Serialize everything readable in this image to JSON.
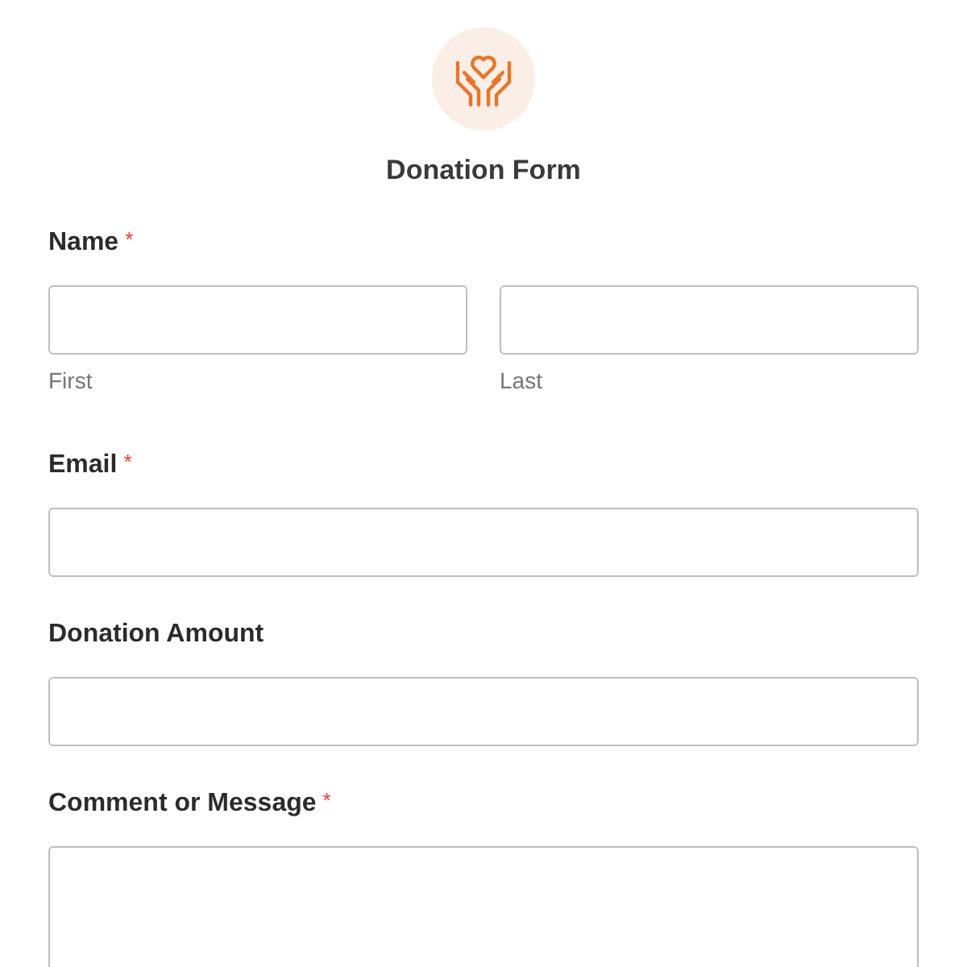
{
  "form": {
    "title": "Donation Form"
  },
  "fields": [
    {
      "kind": "name",
      "label": "Name",
      "required_mark": "*",
      "parts": [
        {
          "sublabel": "First"
        },
        {
          "sublabel": "Last"
        }
      ]
    },
    {
      "kind": "text",
      "label": "Email",
      "required_mark": "*"
    },
    {
      "kind": "text",
      "label": "Donation Amount"
    },
    {
      "kind": "textarea",
      "label": "Comment or Message",
      "required_mark": "*"
    }
  ]
}
